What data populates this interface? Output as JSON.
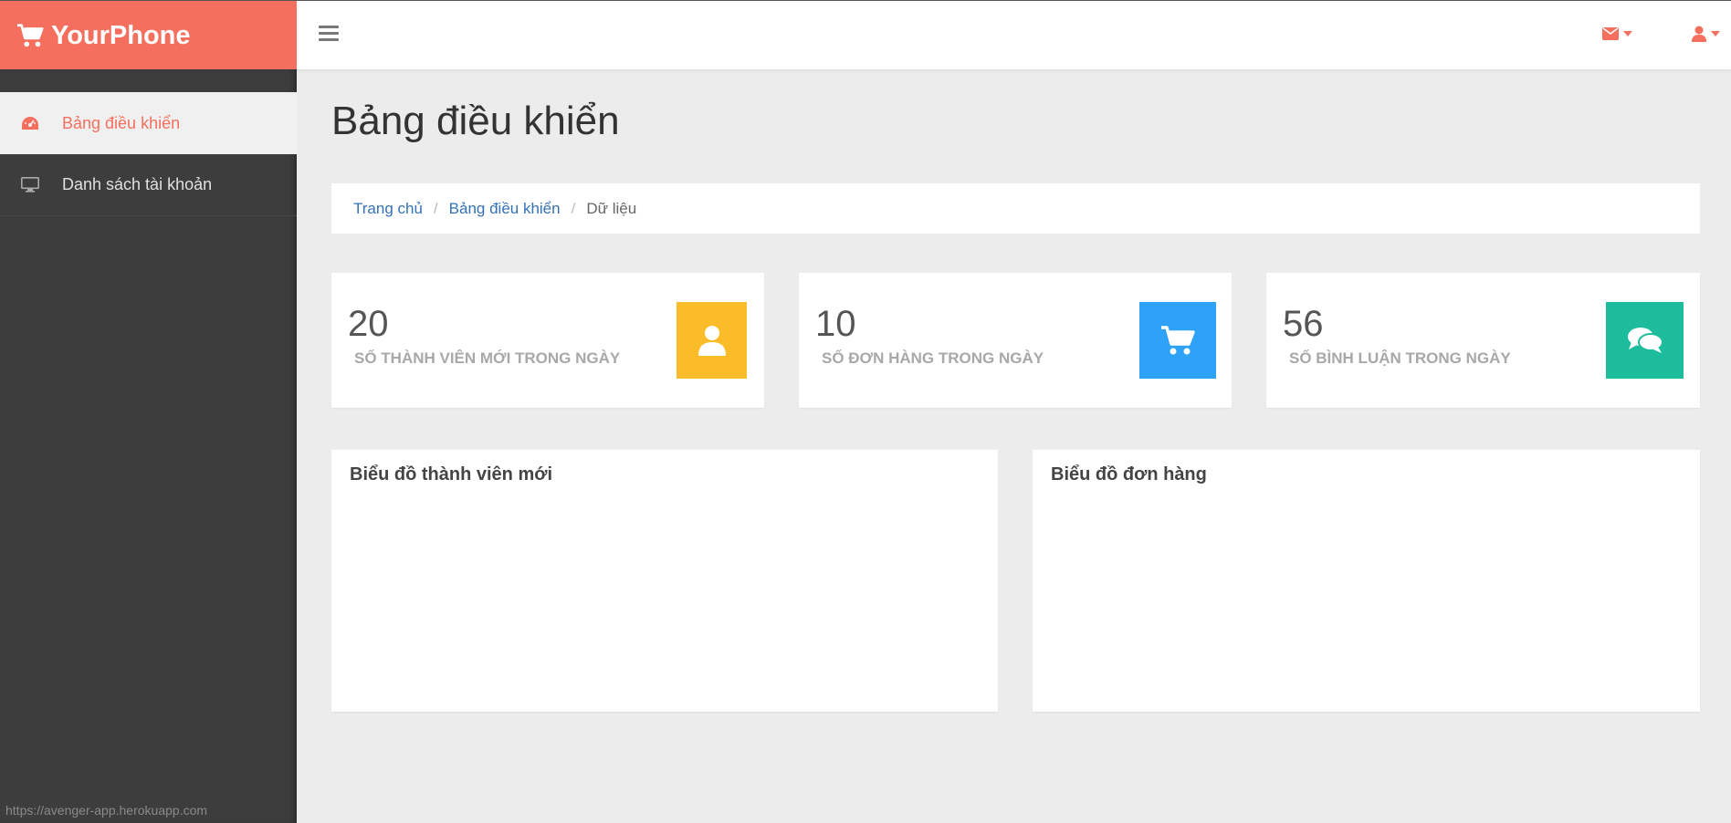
{
  "brand": {
    "name": "YourPhone",
    "icon": "shopping-cart-icon",
    "color": "#f46f5e"
  },
  "topbar": {
    "menu_icon": "hamburger-icon",
    "mail_icon": "envelope-icon",
    "user_icon": "user-icon"
  },
  "sidebar": {
    "items": [
      {
        "label": "Bảng điều khiển",
        "icon": "dashboard-icon",
        "active": true
      },
      {
        "label": "Danh sách tài khoản",
        "icon": "desktop-icon",
        "active": false
      }
    ]
  },
  "status_bar": {
    "url": "https://avenger-app.herokuapp.com"
  },
  "main": {
    "title": "Bảng điều khiển",
    "breadcrumb": [
      {
        "label": "Trang chủ"
      },
      {
        "label": "Bảng điều khiển"
      },
      {
        "label": "Dữ liệu"
      }
    ],
    "stats": [
      {
        "value": "20",
        "label": "SỐ THÀNH VIÊN MỚI TRONG NGÀY",
        "icon": "user-icon",
        "color": "#fbbc2a"
      },
      {
        "value": "10",
        "label": "SỐ ĐƠN HÀNG TRONG NGÀY",
        "icon": "shopping-cart-icon",
        "color": "#2ea2f8"
      },
      {
        "value": "56",
        "label": "SỐ BÌNH LUẬN TRONG NGÀY",
        "icon": "comments-icon",
        "color": "#1dbc9c"
      }
    ],
    "panels": [
      {
        "title": "Biểu đồ thành viên mới"
      },
      {
        "title": "Biểu đồ đơn hàng"
      }
    ]
  }
}
